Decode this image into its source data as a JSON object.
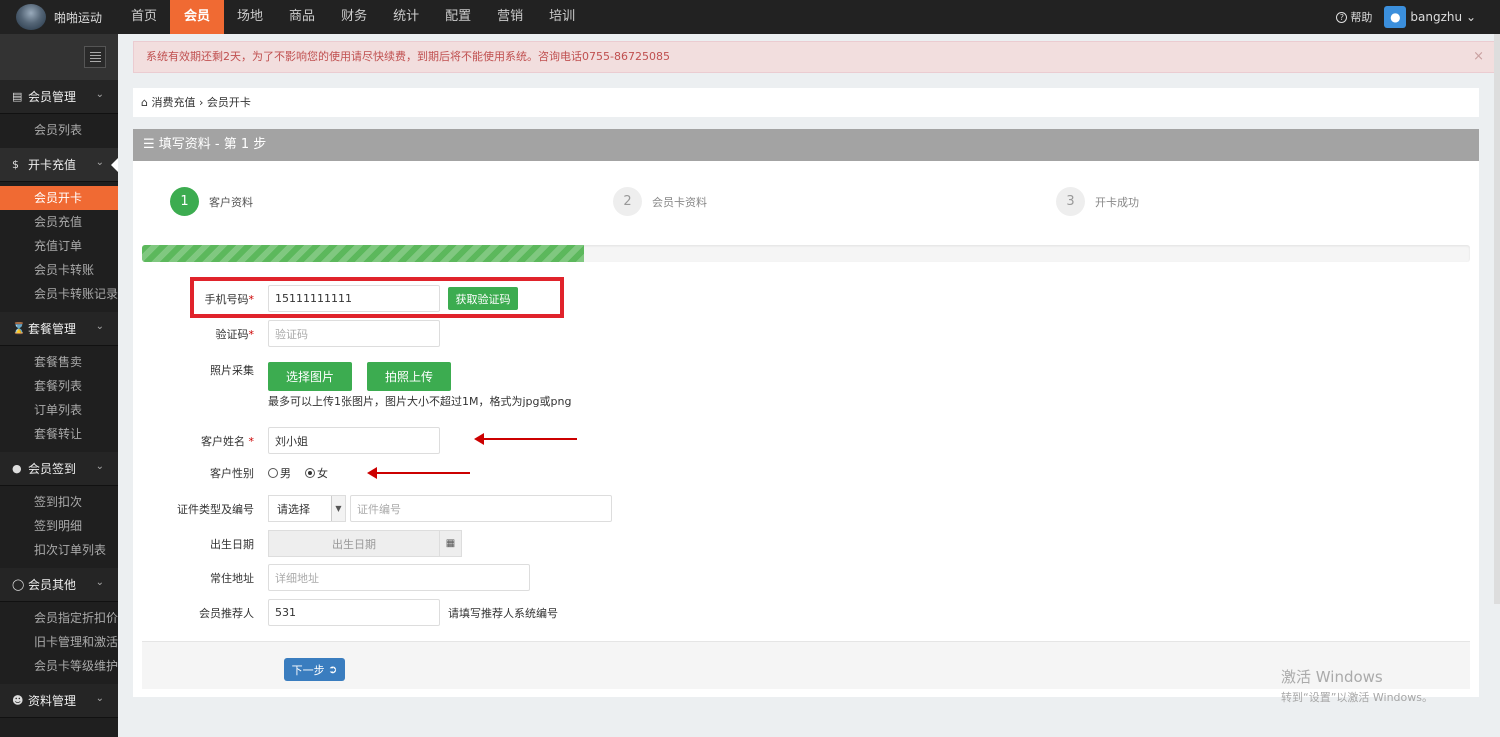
{
  "topbar": {
    "brand": "啪啪运动",
    "nav": [
      "首页",
      "会员",
      "场地",
      "商品",
      "财务",
      "统计",
      "配置",
      "营销",
      "培训"
    ],
    "active_nav": "会员",
    "help": "帮助",
    "user": "bangzhu",
    "help_icon": "question-circle-icon",
    "avatar_icon": "users-icon"
  },
  "sidebar": {
    "groups": [
      {
        "label": "会员管理",
        "icon": "id-card-icon",
        "items": [
          "会员列表"
        ]
      },
      {
        "label": "开卡充值",
        "icon": "dollar-icon",
        "items": [
          "会员开卡",
          "会员充值",
          "充值订单",
          "会员卡转账",
          "会员卡转账记录"
        ]
      },
      {
        "label": "套餐管理",
        "icon": "hourglass-icon",
        "items": [
          "套餐售卖",
          "套餐列表",
          "订单列表",
          "套餐转让"
        ]
      },
      {
        "label": "会员签到",
        "icon": "map-marker-icon",
        "items": [
          "签到扣次",
          "签到明细",
          "扣次订单列表"
        ]
      },
      {
        "label": "会员其他",
        "icon": "circle-notch-icon",
        "items": [
          "会员指定折扣价",
          "旧卡管理和激活",
          "会员卡等级维护"
        ]
      },
      {
        "label": "资料管理",
        "icon": "users-icon",
        "items": []
      }
    ],
    "active_item": "会员开卡"
  },
  "alert": {
    "text": "系统有效期还剩2天，为了不影响您的使用请尽快续费，到期后将不能使用系统。咨询电话0755-86725085",
    "close": "×"
  },
  "breadcrumb": {
    "home": "消费充值",
    "separator": "›",
    "current": "会员开卡"
  },
  "panel": {
    "title": "填写资料 - 第 1 步"
  },
  "steps": [
    {
      "num": "1",
      "label": "客户资料"
    },
    {
      "num": "2",
      "label": "会员卡资料"
    },
    {
      "num": "3",
      "label": "开卡成功"
    }
  ],
  "progress": {
    "fraction": 0.333
  },
  "form": {
    "phone": {
      "label": "手机号码",
      "value": "15111111111",
      "button": "获取验证码"
    },
    "code": {
      "label": "验证码",
      "placeholder": "验证码"
    },
    "photo": {
      "label": "照片采集",
      "btn_select": "选择图片",
      "btn_camera": "拍照上传",
      "hint": "最多可以上传1张图片，图片大小不超过1M，格式为jpg或png"
    },
    "name": {
      "label": "客户姓名",
      "value": "刘小姐"
    },
    "gender": {
      "label": "客户性别",
      "male": "男",
      "female": "女",
      "selected": "女"
    },
    "id": {
      "label": "证件类型及编号",
      "select": "请选择",
      "placeholder": "证件编号"
    },
    "birth": {
      "label": "出生日期",
      "placeholder": "出生日期"
    },
    "address": {
      "label": "常住地址",
      "placeholder": "详细地址"
    },
    "referrer": {
      "label": "会员推荐人",
      "value": "531",
      "hint": "请填写推荐人系统编号"
    },
    "required_mark": "*"
  },
  "next_button": "下一步",
  "watermark": {
    "line1": "激活 Windows",
    "line2": "转到“设置”以激活 Windows。"
  },
  "colors": {
    "accent": "#f06a33",
    "green": "#3cac50",
    "blue": "#3a7dbf",
    "annotation": "#e0232b"
  }
}
